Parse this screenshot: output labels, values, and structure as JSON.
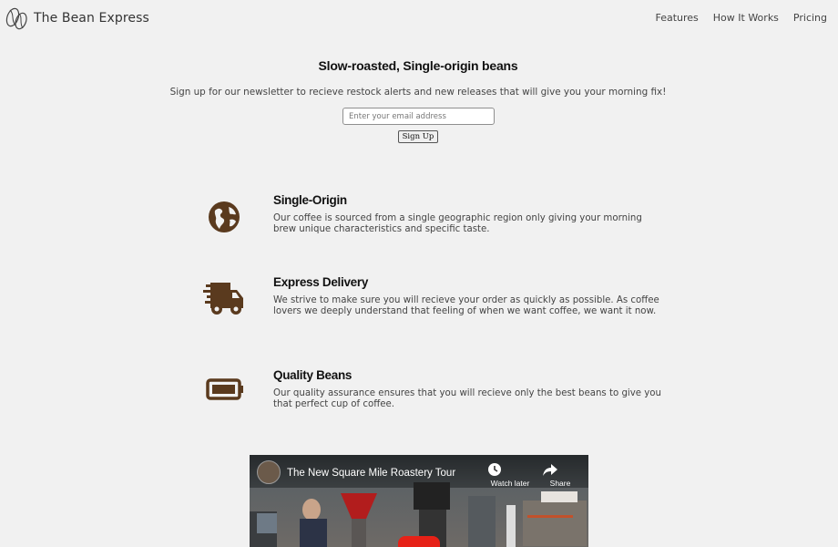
{
  "header": {
    "brand": "The Bean Express",
    "nav": [
      {
        "label": "Features"
      },
      {
        "label": "How It Works"
      },
      {
        "label": "Pricing"
      }
    ]
  },
  "hero": {
    "title": "Slow-roasted, Single-origin beans",
    "subtitle": "Sign up for our newsletter to recieve restock alerts and new releases that will give you your morning fix!",
    "email_placeholder": "Enter your email address",
    "signup_label": "Sign Up"
  },
  "features": [
    {
      "icon": "globe-icon",
      "title": "Single-Origin",
      "description": "Our coffee is sourced from a single geographic region only giving your morning brew unique characteristics and specific taste."
    },
    {
      "icon": "truck-icon",
      "title": "Express Delivery",
      "description": "We strive to make sure you will recieve your order as quickly as possible. As coffee lovers we deeply understand that feeling of when we want coffee, we want it now."
    },
    {
      "icon": "battery-icon",
      "title": "Quality Beans",
      "description": "Our quality assurance ensures that you will recieve only the best beans to give you that perfect cup of coffee."
    }
  ],
  "video": {
    "title": "The New Square Mile Roastery Tour",
    "watch_later_label": "Watch later",
    "share_label": "Share"
  },
  "colors": {
    "background": "#f1f1f1",
    "icon_brown": "#5a3a1e",
    "play_red": "#e62117"
  }
}
